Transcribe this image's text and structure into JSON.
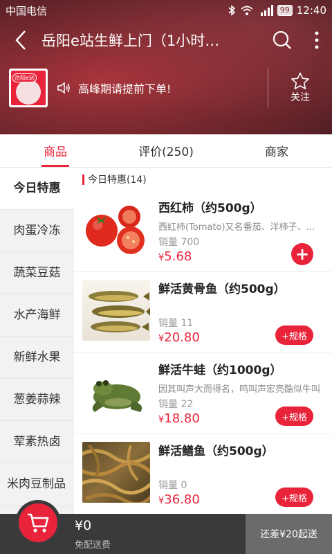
{
  "status_bar": {
    "carrier": "中国电信",
    "battery": "99",
    "time": "12:40",
    "network": "4G"
  },
  "nav": {
    "title": "岳阳e站生鲜上门（1小时…"
  },
  "shop": {
    "notice": "高峰期请提前下单!",
    "follow_label": "关注",
    "logo_text": "岳阳e站"
  },
  "tabs": [
    {
      "label": "商品",
      "active": true
    },
    {
      "label": "评价(250)",
      "active": false
    },
    {
      "label": "商家",
      "active": false
    }
  ],
  "categories": [
    {
      "label": "今日特惠",
      "active": true
    },
    {
      "label": "肉蛋冷冻"
    },
    {
      "label": "蔬菜豆菇"
    },
    {
      "label": "水产海鲜"
    },
    {
      "label": "新鲜水果"
    },
    {
      "label": "葱姜蒜辣"
    },
    {
      "label": "荤素热卤"
    },
    {
      "label": "米肉豆制品"
    }
  ],
  "section": {
    "title": "今日特惠(14)"
  },
  "products": [
    {
      "name": "西红柿（约500g）",
      "desc": "西红柿(Tomato)又名番茄、洋柿子、番柿等，",
      "sales": "销量 700",
      "currency": "¥",
      "price": "5.68",
      "button": "+"
    },
    {
      "name": "鲜活黄骨鱼（约500g）",
      "desc": "",
      "sales": "销量 11",
      "currency": "¥",
      "price": "20.80",
      "button": "+规格"
    },
    {
      "name": "鲜活牛蛙（约1000g）",
      "desc": "因其叫声大而得名，鸣叫声宏亮酷似牛叫",
      "sales": "销量 22",
      "currency": "¥",
      "price": "18.80",
      "button": "+规格"
    },
    {
      "name": "鲜活鳝鱼（约500g）",
      "desc": "",
      "sales": "销量 0",
      "currency": "¥",
      "price": "36.80",
      "button": "+规格"
    }
  ],
  "cart": {
    "total": "¥0",
    "delivery": "免配送费",
    "min_order": "还差¥20起送"
  },
  "colors": {
    "accent": "#e8233a",
    "bar_dark": "#3a3a3a",
    "bar_grey": "#6b6b6b"
  }
}
